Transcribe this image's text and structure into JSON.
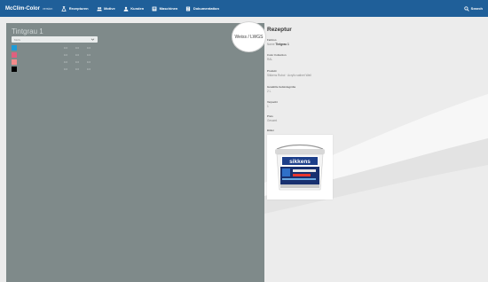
{
  "topbar": {
    "brand": "McClim-Color",
    "version": "version",
    "nav": [
      {
        "label": "Rezepturen",
        "icon": "flask-icon"
      },
      {
        "label": "Motive",
        "icon": "people-icon"
      },
      {
        "label": "Kunden",
        "icon": "user-icon"
      },
      {
        "label": "Maschinen",
        "icon": "machine-icon"
      },
      {
        "label": "Dokumentation",
        "icon": "document-icon"
      }
    ],
    "search_label": "Search",
    "colors": {
      "bar": "#1f5f99"
    }
  },
  "preview": {
    "title": "Tintgrau 1",
    "badge": "Weiss / LWGS",
    "selector_value": "Motiv",
    "background": "#7f8a8a",
    "colors": [
      {
        "name": "",
        "swatch": "#1e9bd7",
        "values": [
          "0.0",
          "0.0",
          "0.0"
        ]
      },
      {
        "name": "",
        "swatch": "#e0607e",
        "values": [
          "0.0",
          "0.0",
          "0.0"
        ]
      },
      {
        "name": "",
        "swatch": "#f28a8a",
        "values": [
          "0.0",
          "0.0",
          "0.0"
        ]
      },
      {
        "name": "",
        "swatch": "#000000",
        "values": [
          "0.0",
          "0.0",
          "0.0"
        ]
      }
    ]
  },
  "recipe": {
    "title": "Rezeptur",
    "fields": [
      {
        "label": "Farbton",
        "prefix": "Name",
        "value": "Tintgrau 1"
      },
      {
        "label": "Color Collection",
        "value": "RAL"
      },
      {
        "label": "Produkt",
        "value": "Sikkens Rubol · Acrylic satinet Wall"
      },
      {
        "label": "Gewählte Gebindegröße",
        "value": "2 L"
      },
      {
        "label": "Verpackt",
        "value": "1"
      },
      {
        "label": "Preis",
        "value": "Gesamt"
      },
      {
        "label": "Bilder",
        "value": ""
      }
    ],
    "product_brand": "sikkens"
  }
}
